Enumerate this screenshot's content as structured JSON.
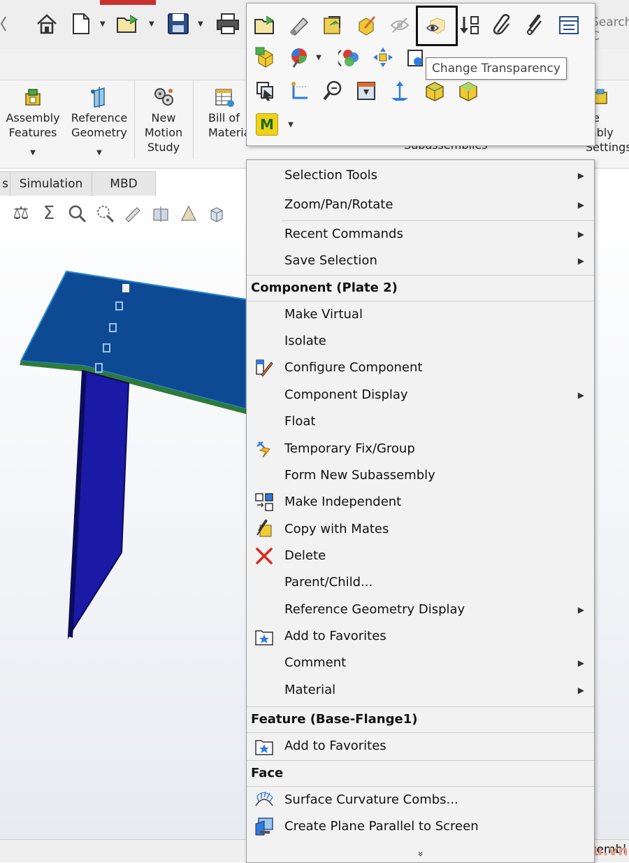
{
  "search": {
    "placeholder": "Search C"
  },
  "ribbon": {
    "buttons": [
      {
        "label": "Assembly\nFeatures"
      },
      {
        "label": "Reference\nGeometry"
      },
      {
        "label": "New\nMotion\nStudy"
      },
      {
        "label": "Bill of\nMaterial"
      }
    ],
    "partial_right": "ge\nmbly\nSettings",
    "partial_sub": "Subassemblies"
  },
  "tabs": [
    {
      "label": "s"
    },
    {
      "label": "Simulation"
    },
    {
      "label": "MBD"
    }
  ],
  "toolbar": {
    "tooltip": "Change Transparency",
    "selected_tool_icon": "change-transparency-icon",
    "m_badge": "M"
  },
  "menu": {
    "items_top": [
      {
        "label": "Selection Tools",
        "submenu": true
      },
      {
        "label": "Zoom/Pan/Rotate",
        "submenu": true
      },
      {
        "label": "Recent Commands",
        "submenu": true
      },
      {
        "label": "Save Selection",
        "submenu": true
      }
    ],
    "section_component": "Component (Plate 2)",
    "items_component": [
      {
        "label": "Make Virtual",
        "icon": "",
        "submenu": false
      },
      {
        "label": "Isolate",
        "icon": "",
        "submenu": false
      },
      {
        "label": "Configure Component",
        "icon": "configure-component-icon",
        "submenu": false
      },
      {
        "label": "Component Display",
        "icon": "",
        "submenu": true
      },
      {
        "label": "Float",
        "icon": "",
        "submenu": false
      },
      {
        "label": "Temporary Fix/Group",
        "icon": "temporary-fix-icon",
        "submenu": false
      },
      {
        "label": "Form New Subassembly",
        "icon": "",
        "submenu": false
      },
      {
        "label": "Make Independent",
        "icon": "make-independent-icon",
        "submenu": false
      },
      {
        "label": "Copy with Mates",
        "icon": "copy-with-mates-icon",
        "submenu": false
      },
      {
        "label": "Delete",
        "icon": "delete-icon",
        "submenu": false
      },
      {
        "label": "Parent/Child...",
        "icon": "",
        "submenu": false
      },
      {
        "label": "Reference Geometry Display",
        "icon": "",
        "submenu": true
      },
      {
        "label": "Add to Favorites",
        "icon": "favorites-icon",
        "submenu": false
      },
      {
        "label": "Comment",
        "icon": "",
        "submenu": true
      },
      {
        "label": "Material",
        "icon": "",
        "submenu": true
      }
    ],
    "section_feature": "Feature (Base-Flange1)",
    "items_feature": [
      {
        "label": "Add to Favorites",
        "icon": "favorites-icon",
        "submenu": false
      }
    ],
    "section_face": "Face",
    "items_face": [
      {
        "label": "Surface Curvature Combs...",
        "icon": "curvature-combs-icon",
        "submenu": false
      },
      {
        "label": "Create Plane Parallel to Screen",
        "icon": "plane-parallel-icon",
        "submenu": false
      }
    ],
    "more_glyph": "»"
  },
  "status": {
    "text": "ssembl"
  },
  "watermark": "Cammech.edu.vn",
  "colors": {
    "model_blue": "#0e4a93",
    "model_edge": "#2a8bd0",
    "plate_dark": "#1a1aa6",
    "highlight_border": "#111111",
    "delete_red": "#e0281c"
  }
}
